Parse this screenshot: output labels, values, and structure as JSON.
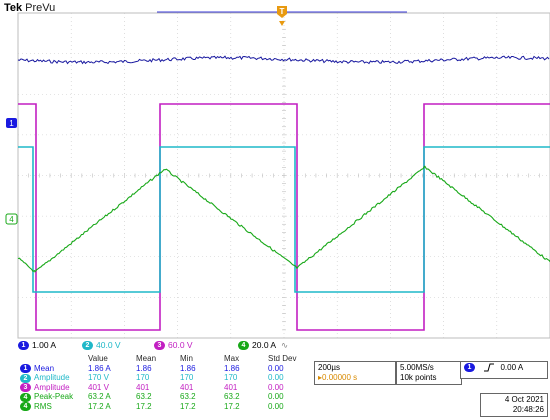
{
  "header": {
    "brand": "Tek",
    "state": "PreVu"
  },
  "trigger_marker": "T",
  "channels": [
    {
      "num": "1",
      "scale": "1.00 A",
      "color": "#1a1ae0",
      "marker": "1",
      "icon": "ch1-badge-icon"
    },
    {
      "num": "2",
      "scale": "40.0 V",
      "color": "#1fb8c8",
      "icon": "ch2-badge-icon"
    },
    {
      "num": "3",
      "scale": "60.0 V",
      "color": "#c21fc2",
      "icon": "ch3-badge-icon"
    },
    {
      "num": "4",
      "scale": "20.0 A",
      "color": "#18a818",
      "marker": "4",
      "icon": "ch4-badge-icon",
      "bw_icon": "∿"
    }
  ],
  "measurements": {
    "headers": [
      "Value",
      "Mean",
      "Min",
      "Max",
      "Std Dev"
    ],
    "rows": [
      {
        "ch": "1",
        "color": "#1a1ae0",
        "name": "Mean",
        "value": "1.86 A",
        "mean": "1.86",
        "min": "1.86",
        "max": "1.86",
        "std": "0.00"
      },
      {
        "ch": "2",
        "color": "#1fb8c8",
        "name": "Amplitude",
        "value": "170 V",
        "mean": "170",
        "min": "170",
        "max": "170",
        "std": "0.00"
      },
      {
        "ch": "3",
        "color": "#c21fc2",
        "name": "Amplitude",
        "value": "401 V",
        "mean": "401",
        "min": "401",
        "max": "401",
        "std": "0.00"
      },
      {
        "ch": "4",
        "color": "#18a818",
        "name": "Peak-Peak",
        "value": "63.2 A",
        "mean": "63.2",
        "min": "63.2",
        "max": "63.2",
        "std": "0.00"
      },
      {
        "ch": "4",
        "color": "#18a818",
        "name": "RMS",
        "value": "17.2 A",
        "mean": "17.2",
        "min": "17.2",
        "max": "17.2",
        "std": "0.00"
      }
    ]
  },
  "timebase": {
    "scale": "200µs",
    "delay": "▸0.00000 s"
  },
  "acquisition": {
    "rate": "5.00MS/s",
    "points": "10k points"
  },
  "trigger": {
    "source": "1",
    "slope_icon": "rising-edge-icon",
    "level": "0.00 A"
  },
  "datetime": {
    "date": "4 Oct  2021",
    "time": "20:48:26"
  }
}
